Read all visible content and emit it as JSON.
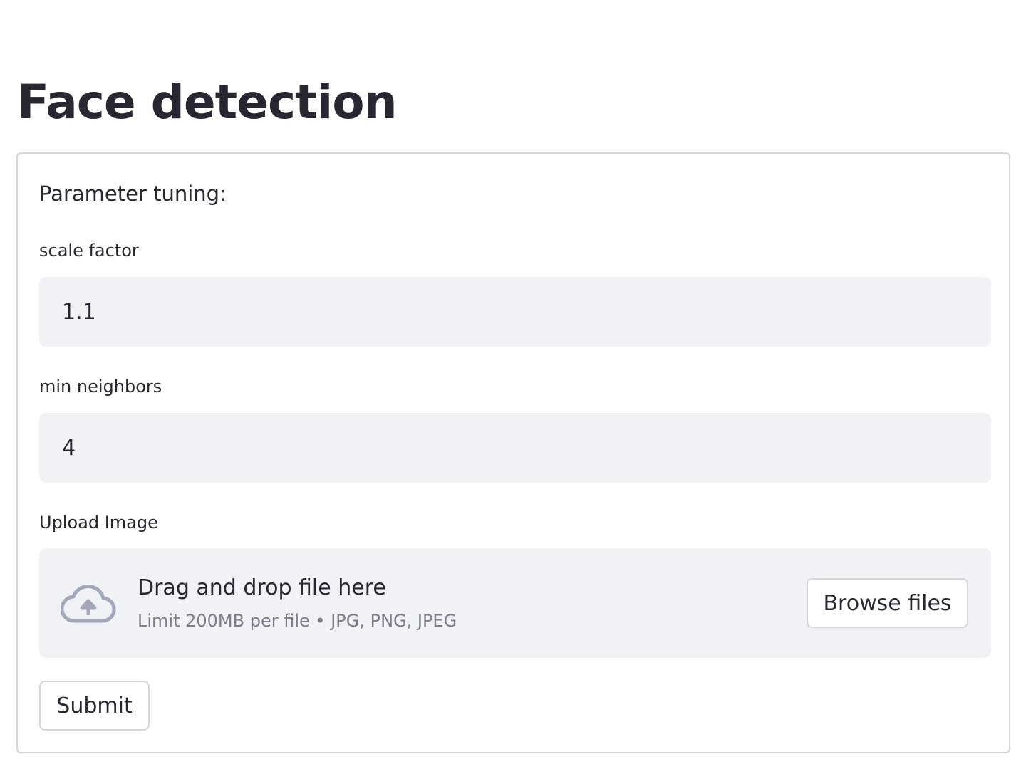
{
  "page": {
    "title": "Face detection"
  },
  "form": {
    "heading": "Parameter tuning:",
    "scale_factor": {
      "label": "scale factor",
      "value": "1.1"
    },
    "min_neighbors": {
      "label": "min neighbors",
      "value": "4"
    },
    "upload": {
      "label": "Upload Image",
      "drop_text": "Drag and drop file here",
      "limit_text": "Limit 200MB per file • JPG, PNG, JPEG",
      "browse_label": "Browse files",
      "icon": "cloud-upload-icon"
    },
    "submit_label": "Submit"
  },
  "colors": {
    "text": "#262730",
    "input_bg": "#f0f2f6",
    "border": "#d6d6d9",
    "muted": "#7c7f8a",
    "icon": "#a3a8b8"
  }
}
